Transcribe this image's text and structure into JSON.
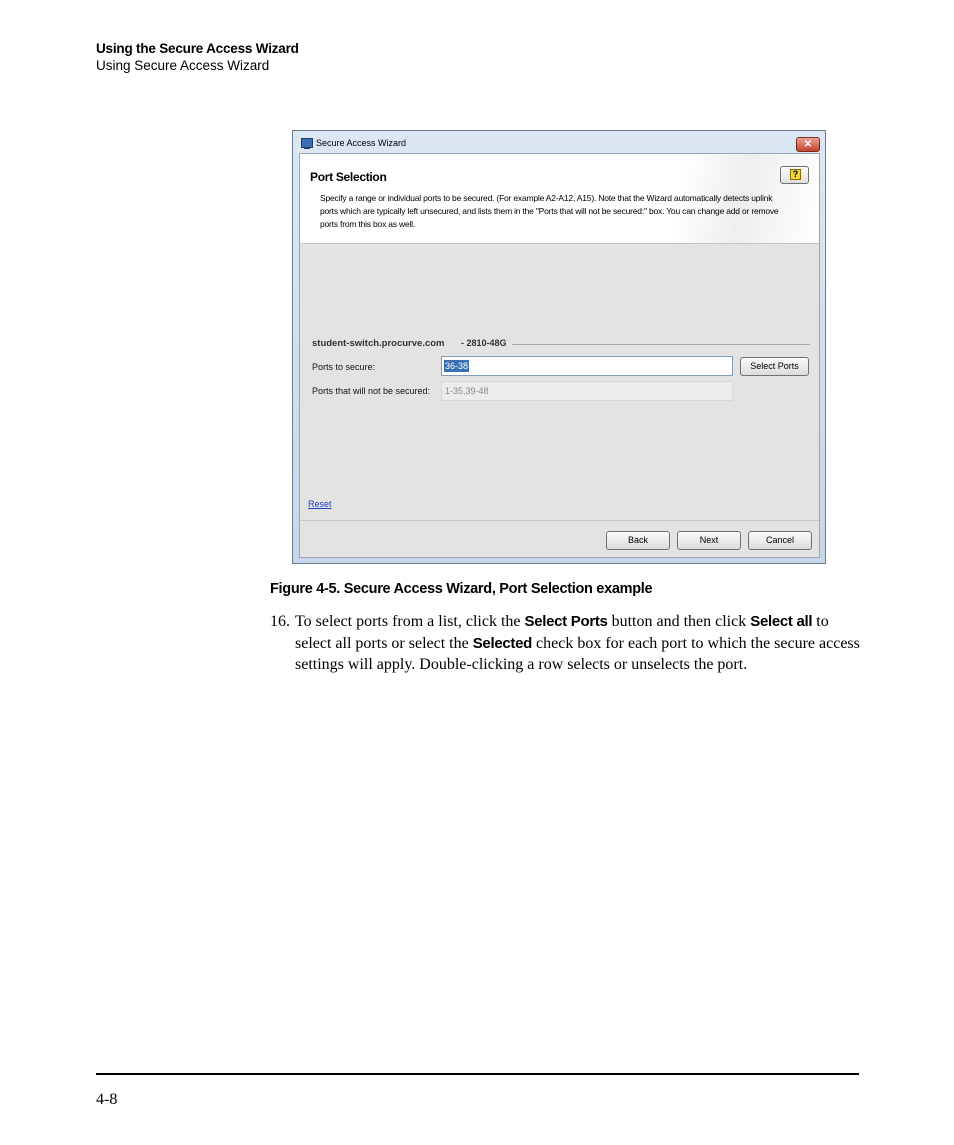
{
  "header": {
    "title": "Using the Secure Access Wizard",
    "subtitle": "Using Secure Access Wizard"
  },
  "dialog": {
    "window_title": "Secure Access Wizard",
    "close_glyph": "✕",
    "banner_title": "Port Selection",
    "banner_description": "Specify a range or individual ports to be secured. (For example A2-A12, A15). Note that the Wizard automatically detects uplink ports which are typically left unsecured, and lists them in the \"Ports that will not be secured:\" box. You can change add or remove ports from this box as well.",
    "help_glyph": "?",
    "switch_name": "student-switch.procurve.com",
    "switch_model": "- 2810-48G",
    "ports_to_secure_label": "Ports to secure:",
    "ports_to_secure_value": "36-38",
    "select_ports_label": "Select Ports",
    "ports_not_secured_label": "Ports that will not be secured:",
    "ports_not_secured_value": "1-35,39-48",
    "reset_label": "Reset",
    "back_label": "Back",
    "next_label": "Next",
    "cancel_label": "Cancel"
  },
  "caption": "Figure 4-5. Secure Access Wizard, Port Selection example",
  "step": {
    "number": "16.",
    "text_1": "To select ports from a list, click the ",
    "bold_1": "Select Ports",
    "text_2": " button and then click ",
    "bold_2": "Select all",
    "text_3": " to select all ports or select the ",
    "bold_3": "Selected",
    "text_4": " check box for each port to which the secure access settings will apply. Double-clicking a row selects or unselects the port."
  },
  "footer": {
    "page_number": "4-8"
  }
}
